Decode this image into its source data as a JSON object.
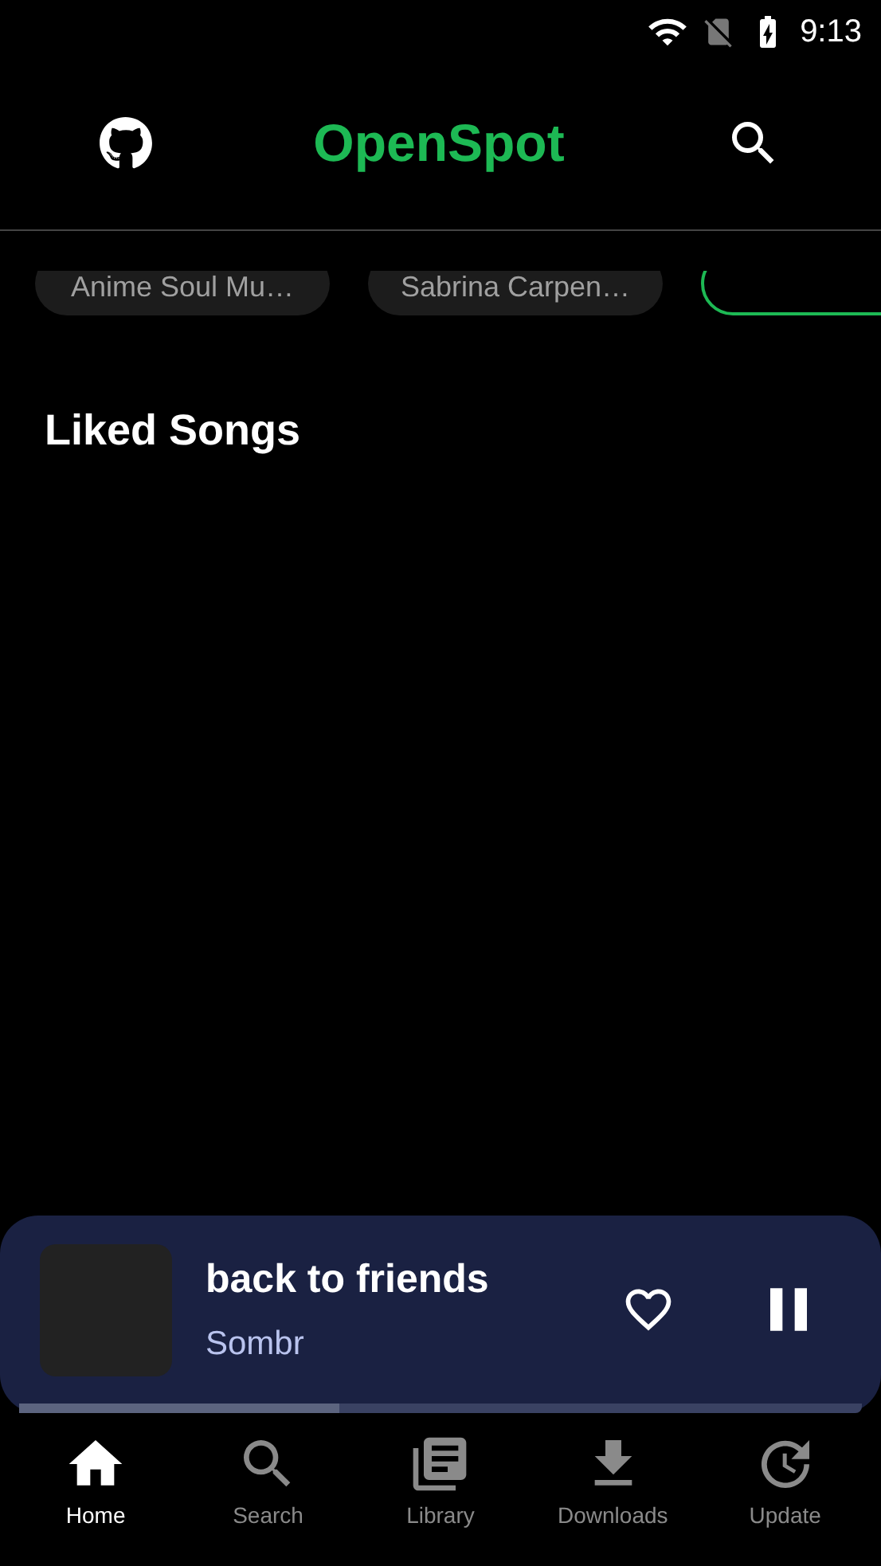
{
  "status_bar": {
    "time": "9:13"
  },
  "header": {
    "title": "OpenSpot"
  },
  "chips": [
    {
      "label": "Anime Soul Mu…",
      "selected": false
    },
    {
      "label": "Sabrina Carpen…",
      "selected": false
    },
    {
      "selected": true
    }
  ],
  "section": {
    "title": "Liked Songs"
  },
  "player": {
    "title": "back to friends",
    "artist": "Sombr",
    "liked": false,
    "playing": true,
    "level": 0.38
  },
  "nav": [
    {
      "label": "Home",
      "kind": "home",
      "selected": true
    },
    {
      "label": "Search",
      "kind": "search",
      "selected": false
    },
    {
      "label": "Library",
      "kind": "library",
      "selected": false
    },
    {
      "label": "Downloads",
      "kind": "downloads",
      "selected": false
    },
    {
      "label": "Update",
      "kind": "update",
      "selected": false
    }
  ]
}
